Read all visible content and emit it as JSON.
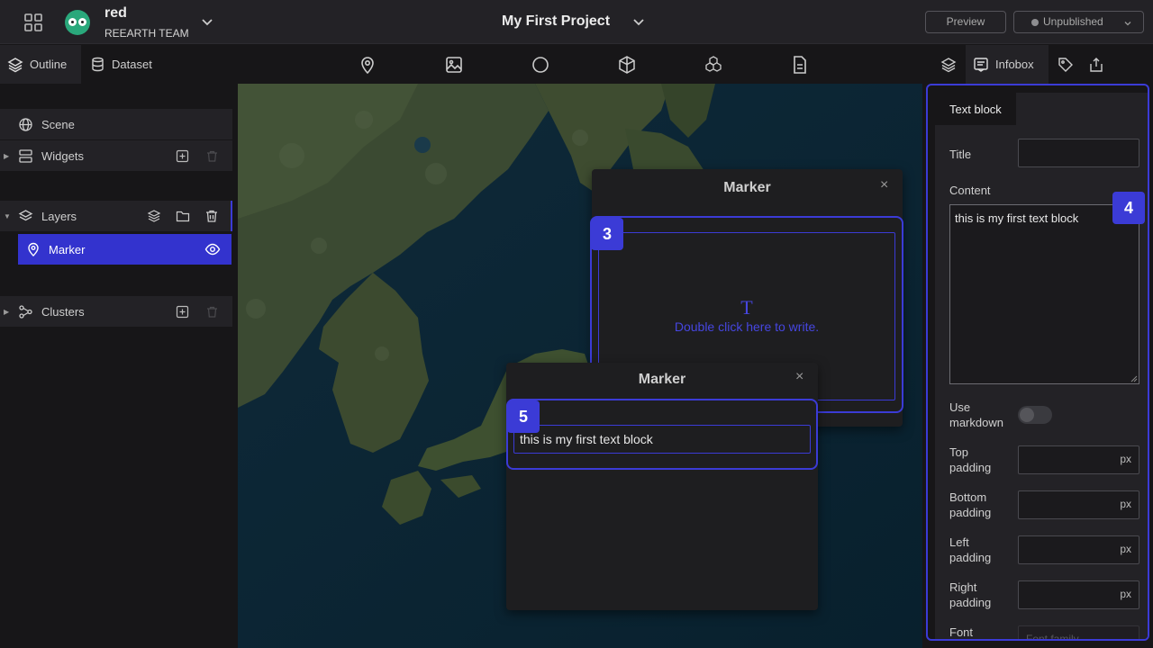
{
  "header": {
    "workspace_name": "red",
    "team_name": "REEARTH TEAM",
    "project_title": "My First Project",
    "preview_label": "Preview",
    "publish_label": "Unpublished"
  },
  "left_tabs": {
    "outline": "Outline",
    "dataset": "Dataset"
  },
  "tools": [
    "marker-icon",
    "photo-icon",
    "circle-icon",
    "3d-model-icon",
    "cluster-icon",
    "file-icon"
  ],
  "right_tabs": {
    "infobox": "Infobox"
  },
  "outline": {
    "scene": "Scene",
    "widgets": "Widgets",
    "layers": "Layers",
    "marker": "Marker",
    "clusters": "Clusters"
  },
  "infobox_back": {
    "title": "Marker",
    "close": "×",
    "badge": "3",
    "placeholder_icon": "T",
    "placeholder_text": "Double click here to write."
  },
  "infobox_front": {
    "title": "Marker",
    "close": "×",
    "badge": "5",
    "block_text": "this is my first text block"
  },
  "property_panel": {
    "tab": "Text block",
    "badge": "4",
    "title_label": "Title",
    "title_value": "",
    "content_label": "Content",
    "content_value": "this is my first text block",
    "markdown_label": "Use markdown",
    "markdown_on": false,
    "top_padding_label": "Top padding",
    "bottom_padding_label": "Bottom padding",
    "left_padding_label": "Left padding",
    "right_padding_label": "Right padding",
    "unit": "px",
    "font_label": "Font",
    "font_placeholder": "Font family"
  },
  "colors": {
    "accent": "#3b3bd6",
    "selected_row": "#3333ce",
    "panel": "#232226",
    "background": "#171618"
  }
}
